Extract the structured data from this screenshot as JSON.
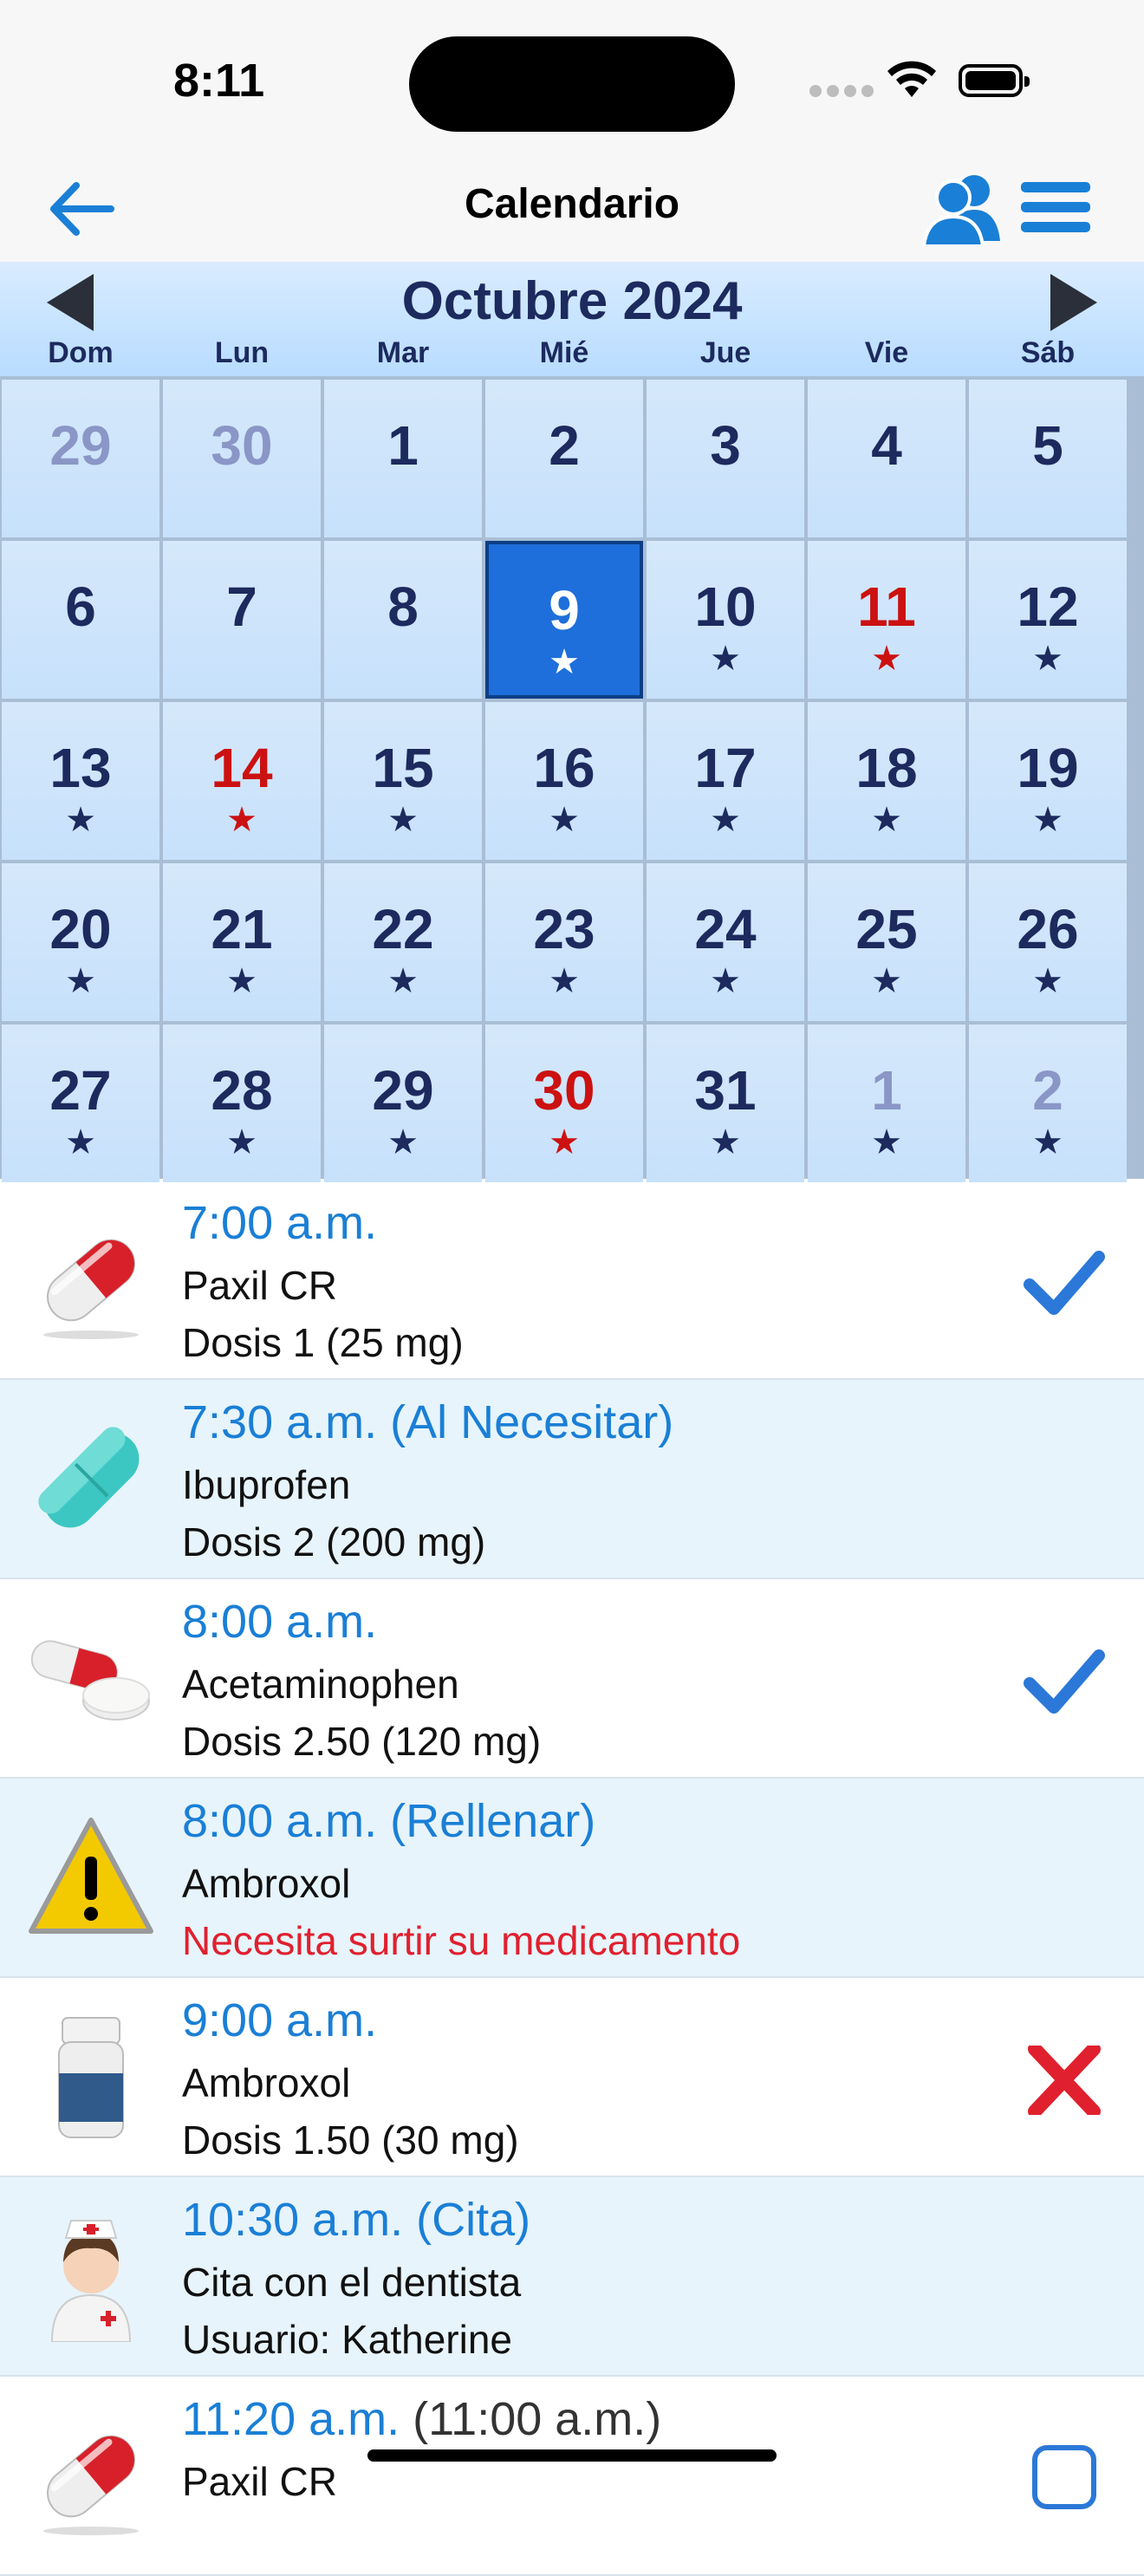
{
  "status_bar": {
    "time": "8:11"
  },
  "navbar": {
    "title": "Calendario"
  },
  "calendar": {
    "month_title": "Octubre 2024",
    "weekdays": [
      "Dom",
      "Lun",
      "Mar",
      "Mié",
      "Jue",
      "Vie",
      "Sáb"
    ],
    "days": [
      {
        "n": "29",
        "state": "other",
        "star": "none"
      },
      {
        "n": "30",
        "state": "other",
        "star": "none"
      },
      {
        "n": "1",
        "state": "normal",
        "star": "none"
      },
      {
        "n": "2",
        "state": "normal",
        "star": "none"
      },
      {
        "n": "3",
        "state": "normal",
        "star": "none"
      },
      {
        "n": "4",
        "state": "normal",
        "star": "none"
      },
      {
        "n": "5",
        "state": "normal",
        "star": "none"
      },
      {
        "n": "6",
        "state": "normal",
        "star": "none"
      },
      {
        "n": "7",
        "state": "normal",
        "star": "none"
      },
      {
        "n": "8",
        "state": "normal",
        "star": "none"
      },
      {
        "n": "9",
        "state": "selected",
        "star": "white"
      },
      {
        "n": "10",
        "state": "normal",
        "star": "blue"
      },
      {
        "n": "11",
        "state": "red",
        "star": "red"
      },
      {
        "n": "12",
        "state": "normal",
        "star": "blue"
      },
      {
        "n": "13",
        "state": "normal",
        "star": "blue"
      },
      {
        "n": "14",
        "state": "red",
        "star": "red"
      },
      {
        "n": "15",
        "state": "normal",
        "star": "blue"
      },
      {
        "n": "16",
        "state": "normal",
        "star": "blue"
      },
      {
        "n": "17",
        "state": "normal",
        "star": "blue"
      },
      {
        "n": "18",
        "state": "normal",
        "star": "blue"
      },
      {
        "n": "19",
        "state": "normal",
        "star": "blue"
      },
      {
        "n": "20",
        "state": "normal",
        "star": "blue"
      },
      {
        "n": "21",
        "state": "normal",
        "star": "blue"
      },
      {
        "n": "22",
        "state": "normal",
        "star": "blue"
      },
      {
        "n": "23",
        "state": "normal",
        "star": "blue"
      },
      {
        "n": "24",
        "state": "normal",
        "star": "blue"
      },
      {
        "n": "25",
        "state": "normal",
        "star": "blue"
      },
      {
        "n": "26",
        "state": "normal",
        "star": "blue"
      },
      {
        "n": "27",
        "state": "normal",
        "star": "blue"
      },
      {
        "n": "28",
        "state": "normal",
        "star": "blue"
      },
      {
        "n": "29",
        "state": "normal",
        "star": "blue"
      },
      {
        "n": "30",
        "state": "red",
        "star": "red"
      },
      {
        "n": "31",
        "state": "normal",
        "star": "blue"
      },
      {
        "n": "1",
        "state": "other",
        "star": "blue"
      },
      {
        "n": "2",
        "state": "other",
        "star": "blue"
      }
    ],
    "colors": {
      "selected": "#1e6fdb",
      "red": "#cc1111",
      "navy": "#1c2a5e"
    }
  },
  "schedule": [
    {
      "time": "7:00 a.m.",
      "suffix": "",
      "name": "Paxil CR",
      "detail": "Dosis 1 (25 mg)",
      "detail_warn": false,
      "icon": "capsule-red-icon",
      "status": "check"
    },
    {
      "time": "7:30 a.m.",
      "suffix": " (Al Necesitar)",
      "name": "Ibuprofen",
      "detail": "Dosis 2 (200 mg)",
      "detail_warn": false,
      "icon": "tablet-teal-icon",
      "status": "none"
    },
    {
      "time": "8:00 a.m.",
      "suffix": "",
      "name": "Acetaminophen",
      "detail": "Dosis 2.50 (120 mg)",
      "detail_warn": false,
      "icon": "pills-icon",
      "status": "check"
    },
    {
      "time": "8:00 a.m.",
      "suffix": " (Rellenar)",
      "name": "Ambroxol",
      "detail": "Necesita surtir su medicamento",
      "detail_warn": true,
      "icon": "warning-icon",
      "status": "none"
    },
    {
      "time": "9:00 a.m.",
      "suffix": "",
      "name": "Ambroxol",
      "detail": "Dosis 1.50 (30 mg)",
      "detail_warn": false,
      "icon": "pill-bottle-icon",
      "status": "cross"
    },
    {
      "time": "10:30 a.m.",
      "suffix": " (Cita)",
      "name": "Cita con el dentista",
      "detail": "Usuario: Katherine",
      "detail_warn": false,
      "icon": "nurse-icon",
      "status": "none"
    },
    {
      "time": "11:20 a.m.",
      "suffix": " (11:00 a.m.)",
      "name": "Paxil CR",
      "detail": "",
      "detail_warn": false,
      "icon": "capsule-red-icon",
      "status": "checkbox"
    }
  ]
}
